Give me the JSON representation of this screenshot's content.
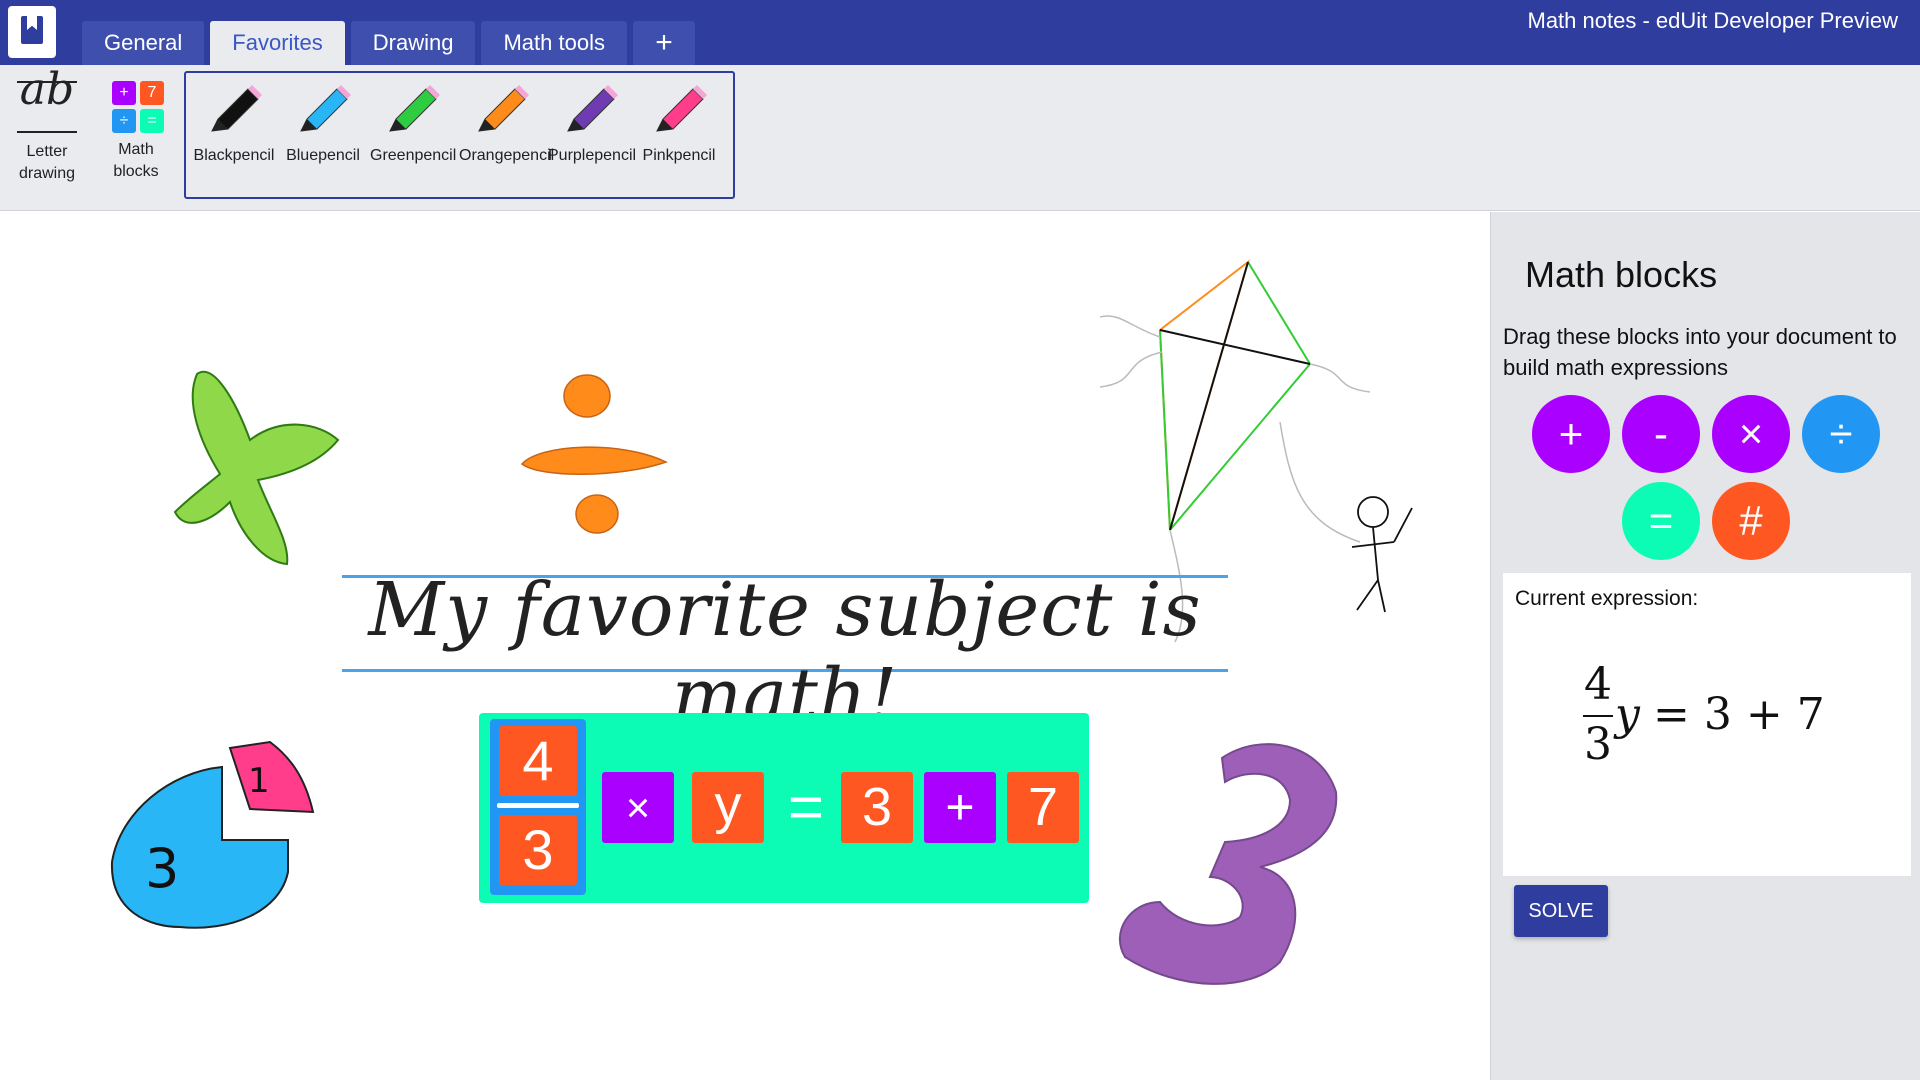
{
  "app": {
    "title": "Math notes - edUit Developer Preview"
  },
  "tabs": [
    {
      "label": "General"
    },
    {
      "label": "Favorites"
    },
    {
      "label": "Drawing"
    },
    {
      "label": "Math tools"
    },
    {
      "label": "+"
    }
  ],
  "ribbon": {
    "letter_drawing": {
      "line1": "Letter",
      "line2": "drawing",
      "glyph": "ab"
    },
    "math_blocks": {
      "line1": "Math",
      "line2": "blocks",
      "glyphs": [
        "+",
        "7",
        "÷",
        "="
      ]
    },
    "pencils": [
      {
        "line1": "Black",
        "line2": "pencil",
        "color": "#111111"
      },
      {
        "line1": "Blue",
        "line2": "pencil",
        "color": "#29b6f6"
      },
      {
        "line1": "Green",
        "line2": "pencil",
        "color": "#2ecc40"
      },
      {
        "line1": "Orange",
        "line2": "pencil",
        "color": "#ff8c1a"
      },
      {
        "line1": "Purple",
        "line2": "pencil",
        "color": "#6f3bb1"
      },
      {
        "line1": "Pink",
        "line2": "pencil",
        "color": "#ff3d8b"
      }
    ]
  },
  "canvas": {
    "handwriting": "My favorite subject is math!",
    "expression_tiles": {
      "numerator": "4",
      "denominator": "3",
      "times": "×",
      "variable": "y",
      "equals": "=",
      "a": "3",
      "plus": "+",
      "b": "7"
    },
    "sketch_labels": {
      "pie_one": "1",
      "pie_three": "3"
    }
  },
  "side_panel": {
    "title": "Math blocks",
    "description": "Drag these blocks into your document to build math expressions",
    "blocks": [
      {
        "symbol": "+",
        "color": "#aa00ff"
      },
      {
        "symbol": "-",
        "color": "#aa00ff"
      },
      {
        "symbol": "×",
        "color": "#aa00ff"
      },
      {
        "symbol": "÷",
        "color": "#2196f3"
      },
      {
        "symbol": "=",
        "color": "#0dfcb5"
      },
      {
        "symbol": "#",
        "color": "#ff5722"
      }
    ],
    "current_expression_label": "Current expression:",
    "math": {
      "numerator": "4",
      "denominator": "3",
      "rest_left": "y",
      "rest_right": "= 3 + 7"
    },
    "solve_label": "SOLVE"
  },
  "colors": {
    "brand": "#2f3e9e",
    "ribbon_bg": "#e9ebee",
    "side_bg": "#e3e5e8",
    "tile_orange": "#ff5722",
    "tile_purple": "#aa00ff",
    "tile_blue": "#2196f3",
    "tile_teal": "#0dfcb5"
  }
}
